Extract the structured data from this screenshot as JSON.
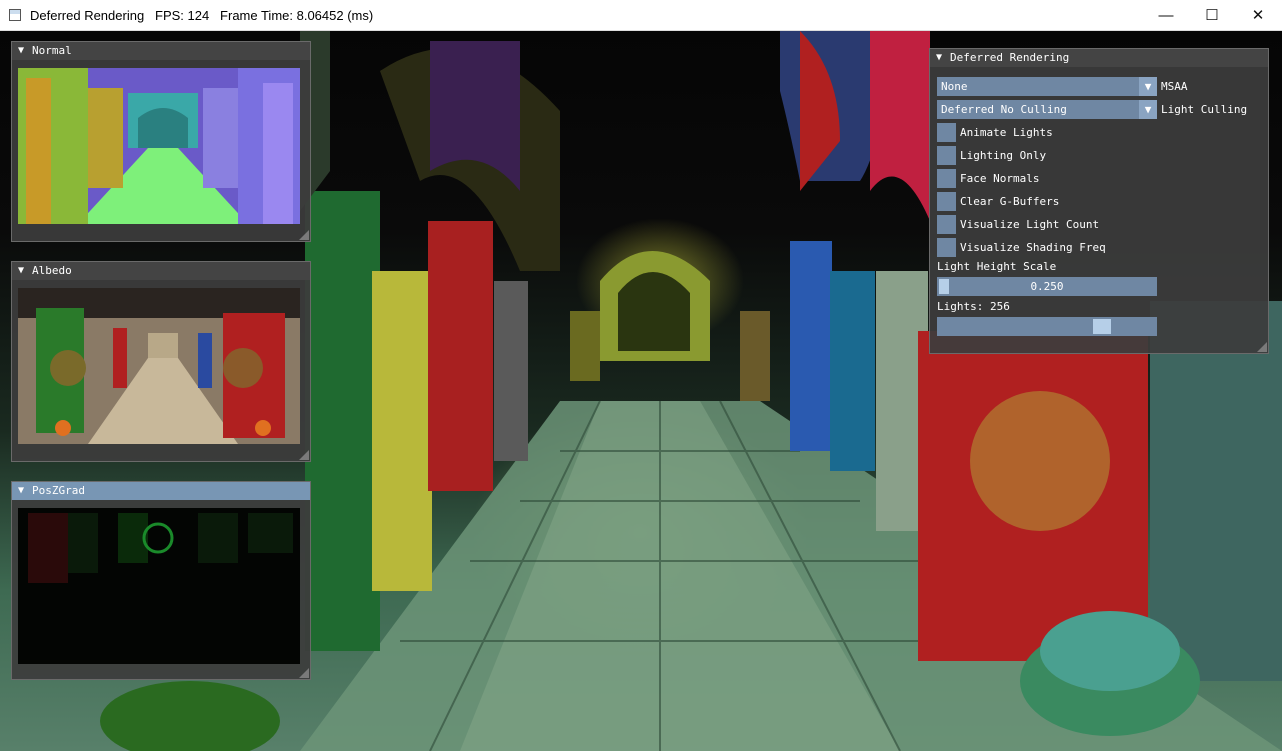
{
  "titlebar": {
    "title": "Deferred Rendering   FPS: 124   Frame Time: 8.06452 (ms)",
    "minimize_glyph": "—",
    "maximize_glyph": "☐",
    "close_glyph": "✕"
  },
  "colors": {
    "imgui_frame": "#6f87a3",
    "imgui_title_active": "#7896b4",
    "imgui_bg": "#3c3c3c"
  },
  "previews": [
    {
      "title": "Normal"
    },
    {
      "title": "Albedo"
    },
    {
      "title": "PosZGrad"
    }
  ],
  "panel": {
    "title": "Deferred Rendering",
    "msaa": {
      "value": "None",
      "label": "MSAA"
    },
    "light_culling": {
      "value": "Deferred No Culling",
      "label": "Light Culling"
    },
    "checkboxes": [
      {
        "label": "Animate Lights",
        "checked": false
      },
      {
        "label": "Lighting Only",
        "checked": false
      },
      {
        "label": "Face Normals",
        "checked": false
      },
      {
        "label": "Clear G-Buffers",
        "checked": false
      },
      {
        "label": "Visualize Light Count",
        "checked": false
      },
      {
        "label": "Visualize Shading Freq",
        "checked": false
      }
    ],
    "light_height": {
      "label": "Light Height Scale",
      "value": "0.250",
      "fraction": 0.0
    },
    "lights": {
      "label": "Lights: 256",
      "fraction": 0.78
    }
  },
  "icons": {
    "collapse": "▼",
    "dropdown": "▼"
  }
}
